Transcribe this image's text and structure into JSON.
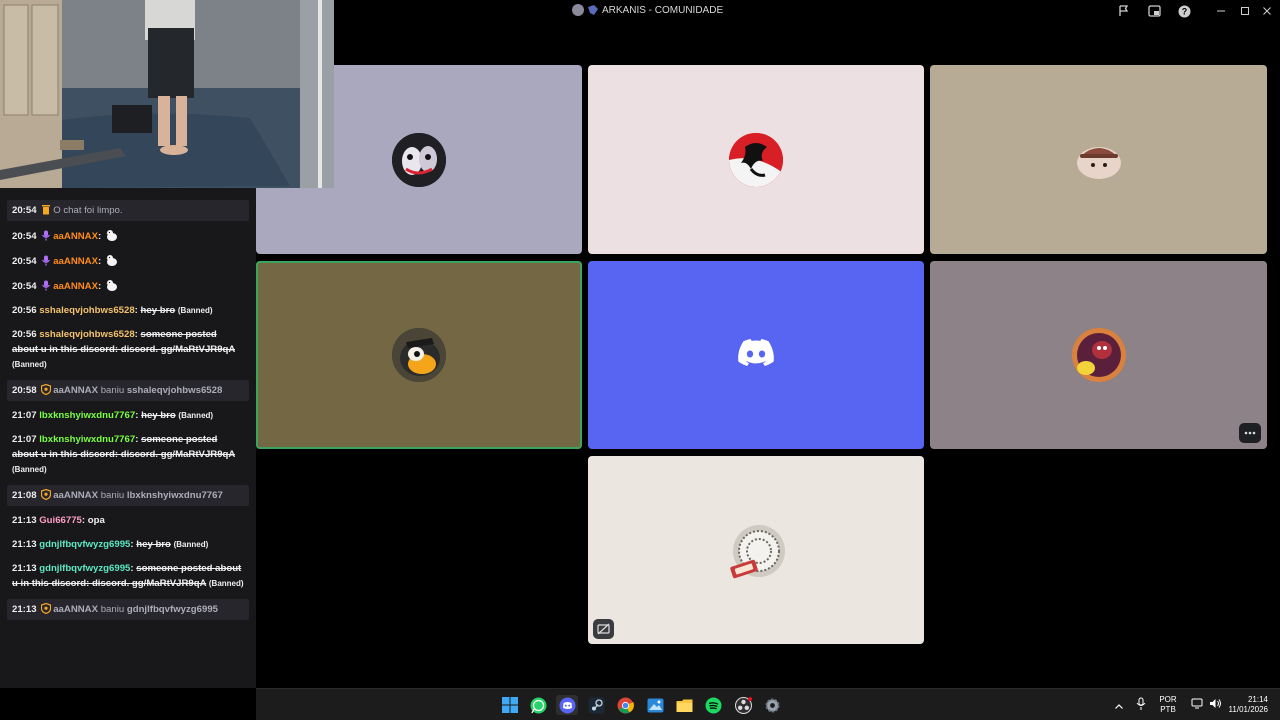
{
  "window": {
    "title": "ARKANIS - COMUNIDADE"
  },
  "chat": {
    "messages": [
      {
        "time": "20:54",
        "type": "system",
        "text": "O chat foi limpo."
      },
      {
        "time": "20:54",
        "type": "user",
        "user": "aaANNAX",
        "color": "#ff8c1a",
        "text": ":"
      },
      {
        "time": "20:54",
        "type": "user",
        "user": "aaANNAX",
        "color": "#ff8c1a",
        "text": ":"
      },
      {
        "time": "20:54",
        "type": "user",
        "user": "aaANNAX",
        "color": "#ff8c1a",
        "text": ":"
      },
      {
        "time": "20:56",
        "type": "deleted",
        "user": "sshaleqvjohbws6528",
        "color": "#f5c36b",
        "text": "hey bro",
        "tag": "(Banned)"
      },
      {
        "time": "20:56",
        "type": "deleted",
        "user": "sshaleqvjohbws6528",
        "color": "#f5c36b",
        "text": "someone posted about u in this discord: discord. gg/MaRtVJR9qA",
        "tag": "(Banned)"
      },
      {
        "time": "20:58",
        "type": "ban",
        "mod": "aaANNAX",
        "verb": "baniu",
        "target": "sshaleqvjohbws6528"
      },
      {
        "time": "21:07",
        "type": "deleted",
        "user": "lbxknshyiwxdnu7767",
        "color": "#7aff3f",
        "text": "hey bro",
        "tag": "(Banned)"
      },
      {
        "time": "21:07",
        "type": "deleted",
        "user": "lbxknshyiwxdnu7767",
        "color": "#7aff3f",
        "text": "someone posted about u in this discord: discord. gg/MaRtVJR9qA",
        "tag": "(Banned)"
      },
      {
        "time": "21:08",
        "type": "ban",
        "mod": "aaANNAX",
        "verb": "baniu",
        "target": "lbxknshyiwxdnu7767"
      },
      {
        "time": "21:13",
        "type": "user",
        "user": "Gui66775",
        "color": "#ff9ec4",
        "text": ": opa"
      },
      {
        "time": "21:13",
        "type": "deleted",
        "user": "gdnjlfbqvfwyzg6995",
        "color": "#5ce8c0",
        "text": "hey bro",
        "tag": "(Banned)"
      },
      {
        "time": "21:13",
        "type": "deleted",
        "user": "gdnjlfbqvfwyzg6995",
        "color": "#5ce8c0",
        "text": "someone posted about u in this discord: discord. gg/MaRtVJR9qA",
        "tag": "(Banned)"
      },
      {
        "time": "21:13",
        "type": "ban",
        "mod": "aaANNAX",
        "verb": "baniu",
        "target": "gdnjlfbqvfwyzg6995"
      }
    ]
  },
  "tiles": [
    {
      "name": "participant-1",
      "bg": "#aaa8bf",
      "speaking": false
    },
    {
      "name": "participant-2",
      "bg": "#ece0e2",
      "speaking": false
    },
    {
      "name": "participant-3",
      "bg": "#b7ab95",
      "speaking": false
    },
    {
      "name": "participant-4",
      "bg": "#736843",
      "speaking": true
    },
    {
      "name": "participant-5",
      "bg": "#5865f2",
      "speaking": false
    },
    {
      "name": "participant-6",
      "bg": "#8c8288",
      "speaking": false
    },
    {
      "name": "participant-7",
      "bg": "#ebe7e0",
      "speaking": false
    }
  ],
  "taskbar": {
    "language_top": "POR",
    "language_bottom": "PTB",
    "clock_time": "21:14",
    "clock_date": "11/01/2026",
    "apps": [
      "start-icon",
      "whatsapp-icon",
      "discord-icon",
      "steam-icon",
      "chrome-icon",
      "photos-icon",
      "file-explorer-icon",
      "spotify-icon",
      "obs-icon",
      "settings-icon"
    ]
  },
  "colors": {
    "discord_blurple": "#5865f2",
    "speaking_ring": "#3ba55d",
    "chat_bg": "#18181b"
  }
}
